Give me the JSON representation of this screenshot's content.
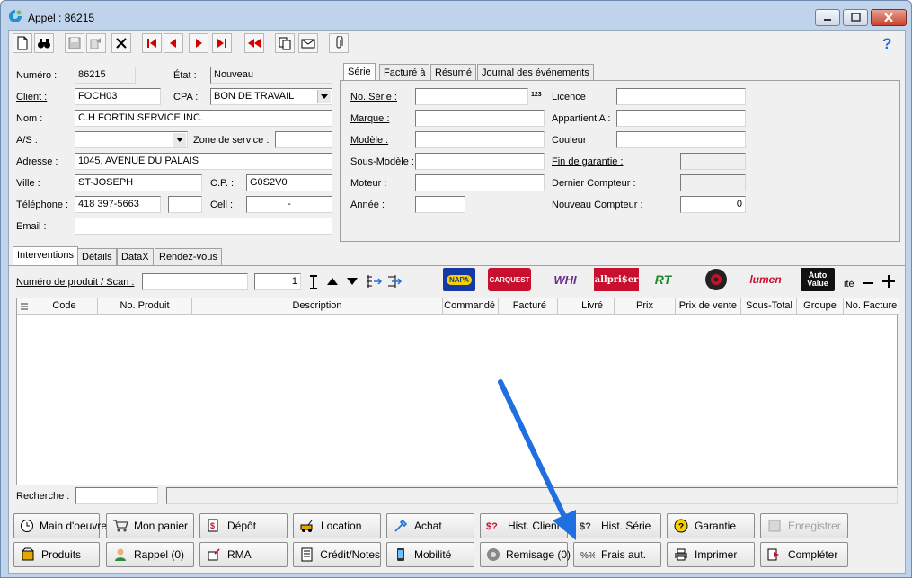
{
  "window": {
    "title": "Appel : 86215"
  },
  "header": {
    "numero_label": "Numéro :",
    "numero_value": "86215",
    "etat_label": "État :",
    "etat_value": "Nouveau",
    "client_label": "Client :",
    "client_value": "FOCH03",
    "cpa_label": "CPA :",
    "cpa_value": "BON DE TRAVAIL",
    "nom_label": "Nom :",
    "nom_value": "C.H FORTIN SERVICE INC.",
    "as_label": "A/S :",
    "as_value": "",
    "zone_label": "Zone de service :",
    "zone_value": "",
    "adresse_label": "Adresse :",
    "adresse_value": "1045, AVENUE DU  PALAIS",
    "ville_label": "Ville :",
    "ville_value": "ST-JOSEPH",
    "cp_label": "C.P. :",
    "cp_value": "G0S2V0",
    "telephone_label": "Téléphone :",
    "telephone_value": "418 397-5663",
    "telephone_ext": "",
    "cell_label": "Cell :",
    "cell_value": "-",
    "email_label": "Email :",
    "email_value": ""
  },
  "top_tabs": [
    "Série",
    "Facturé à",
    "Résumé",
    "Journal des événements"
  ],
  "serie": {
    "no_serie_label": "No. Série :",
    "no_serie_value": "",
    "no_serie_suffix": "123",
    "marque_label": "Marque :",
    "marque_value": "",
    "modele_label": "Modèle :",
    "modele_value": "",
    "sous_modele_label": "Sous-Modèle :",
    "sous_modele_value": "",
    "moteur_label": "Moteur :",
    "moteur_value": "",
    "annee_label": "Année :",
    "annee_value": "",
    "licence_label": "Licence",
    "licence_value": "",
    "appartient_label": "Appartient A :",
    "appartient_value": "",
    "couleur_label": "Couleur",
    "couleur_value": "",
    "fin_garantie_label": "Fin de garantie :",
    "fin_garantie_value": "",
    "dernier_compteur_label": "Dernier Compteur :",
    "dernier_compteur_value": "",
    "nouveau_compteur_label": "Nouveau Compteur :",
    "nouveau_compteur_value": "0"
  },
  "bottom_tabs": [
    "Interventions",
    "Détails",
    "DataX",
    "Rendez-vous"
  ],
  "interventions": {
    "scan_label": "Numéro de produit / Scan :",
    "scan_value": "",
    "qty_value": "1",
    "suppliers": [
      "NAPA",
      "CARQUEST",
      "WHI",
      "allpri$er",
      "RT",
      "",
      "lumen",
      "Auto Value"
    ],
    "ite_label": "ité",
    "columns": [
      "Code",
      "No. Produit",
      "Description",
      "Commandé",
      "Facturé",
      "Livré",
      "Prix",
      "Prix de vente",
      "Sous-Total",
      "Groupe",
      "No. Facture"
    ],
    "search_label": "Recherche :",
    "search_value": ""
  },
  "buttons": {
    "main_oeuvre": "Main d'oeuvre",
    "mon_panier": "Mon panier",
    "depot": "Dépôt",
    "location": "Location",
    "achat": "Achat",
    "hist_client": "Hist. Client",
    "hist_serie": "Hist. Série",
    "garantie": "Garantie",
    "enregistrer": "Enregistrer",
    "produits": "Produits",
    "rappel": "Rappel (0)",
    "rma": "RMA",
    "credit_notes": "Crédit/Notes",
    "mobilite": "Mobilité",
    "remisage": "Remisage (0)",
    "frais_aut": "Frais aut.",
    "imprimer": "Imprimer",
    "completer": "Compléter"
  },
  "colors": {
    "title_bg": "#bfd3ea",
    "arrow": "#1f6fe0",
    "nav_red": "#d40000"
  }
}
